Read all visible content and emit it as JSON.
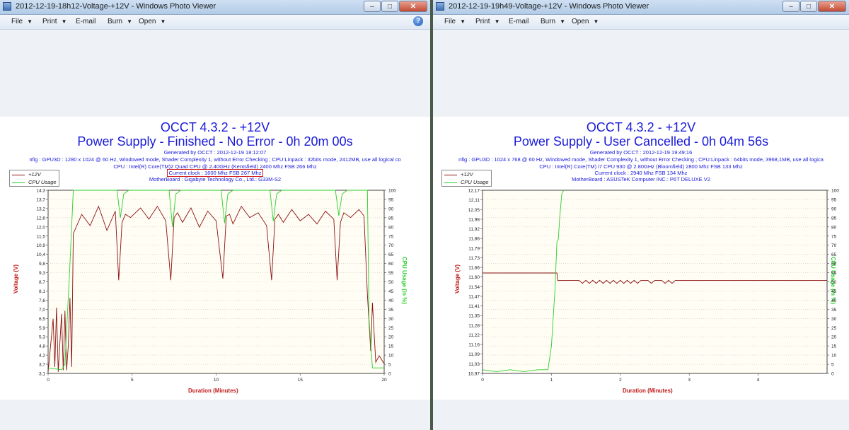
{
  "windows": [
    {
      "title": "2012-12-19-18h12-Voltage-+12V - Windows Photo Viewer",
      "menu": [
        "File",
        "Print",
        "E-mail",
        "Burn",
        "Open"
      ],
      "photo": {
        "title1": "OCCT 4.3.2 - +12V",
        "title2": "Power Supply - Finished - No Error - 0h 20m 00s",
        "generated": "Generated by OCCT : 2012-12-19 18:12:07",
        "config": "nfig : GPU3D : 1280 x 1024 @ 60 Hz, Windowed mode, Shader Complexity 1, without Error Checking ; CPU:Linpack : 32bits mode, 2412MB, use all logical co",
        "cpu": "CPU : Intel(R) Core(TM)2 Quad CPU @ 2.40GHz (Kentsfield) 2400 Mhz FSB 266 Mhz",
        "clock": "Current clock : 1600 Mhz FSB 267 Mhz",
        "mobo": "MotherBoard : Gigabyte Technology Co., Ltd.: G33M-S2",
        "legend_voltage": "+12V",
        "legend_cpu": "CPU Usage",
        "ylabel_left": "Voltage (V)",
        "ylabel_right": "CPU Usage (in %)",
        "xlabel": "Duration (Minutes)"
      },
      "chart_data": {
        "type": "line",
        "x_range": [
          0,
          20
        ],
        "x_ticks": [
          "0",
          "5",
          "10",
          "15",
          "20"
        ],
        "y_left_ticks": [
          "3,1",
          "3,7",
          "4,2",
          "4,8",
          "5,3",
          "5,9",
          "6,5",
          "7,0",
          "7,6",
          "8,1",
          "8,7",
          "9,3",
          "9,8",
          "10,4",
          "10,9",
          "11,5",
          "12,0",
          "12,6",
          "13,2",
          "13,7",
          "14,3"
        ],
        "y_left_range": [
          3.1,
          14.5
        ],
        "y_right_ticks": [
          "0",
          "5",
          "10",
          "15",
          "20",
          "25",
          "30",
          "35",
          "40",
          "45",
          "50",
          "55",
          "60",
          "65",
          "70",
          "75",
          "80",
          "85",
          "90",
          "95",
          "100"
        ],
        "y_right_range": [
          0,
          100
        ],
        "series": [
          {
            "name": "+12V",
            "axis": "left",
            "color": "#8b1010",
            "x": [
              0,
              0.3,
              0.4,
              0.5,
              0.6,
              0.8,
              0.9,
              1.0,
              1.1,
              1.2,
              1.3,
              1.4,
              1.5,
              2.0,
              2.5,
              3.0,
              3.5,
              4.0,
              4.2,
              4.4,
              4.6,
              4.9,
              5.5,
              6.0,
              6.5,
              7.0,
              7.3,
              7.5,
              7.7,
              8.0,
              8.5,
              9.0,
              9.5,
              10.0,
              10.4,
              10.6,
              10.8,
              11.0,
              11.5,
              12.0,
              12.5,
              13.0,
              13.3,
              13.5,
              13.7,
              14.0,
              14.5,
              15.0,
              15.5,
              16.0,
              16.5,
              17.0,
              17.2,
              17.4,
              17.6,
              18.0,
              18.5,
              18.8,
              19.0,
              19.2,
              19.3,
              19.5,
              19.7,
              20.0
            ],
            "y": [
              3.2,
              6.5,
              3.5,
              7.2,
              3.2,
              6.8,
              3.3,
              7.0,
              3.3,
              4.8,
              7.8,
              3.5,
              11.8,
              13.0,
              12.3,
              13.5,
              12.0,
              13.2,
              8.9,
              12.5,
              13.0,
              12.8,
              13.4,
              12.7,
              13.5,
              12.6,
              8.9,
              12.8,
              13.1,
              12.5,
              13.4,
              12.2,
              13.2,
              12.6,
              9.0,
              12.9,
              13.0,
              12.4,
              13.5,
              12.8,
              13.1,
              12.3,
              8.9,
              12.7,
              13.0,
              12.5,
              13.3,
              12.6,
              13.0,
              12.4,
              13.2,
              12.7,
              8.9,
              12.5,
              13.1,
              12.8,
              13.3,
              12.9,
              8.0,
              4.5,
              7.5,
              3.8,
              4.2,
              3.7
            ]
          },
          {
            "name": "CPU Usage",
            "axis": "right",
            "color": "#29d129",
            "x": [
              0,
              0.8,
              1.0,
              1.3,
              1.5,
              1.7,
              4.1,
              4.3,
              4.5,
              4.8,
              7.2,
              7.4,
              7.6,
              7.9,
              10.3,
              10.5,
              10.7,
              11.0,
              13.2,
              13.4,
              13.6,
              13.9,
              17.1,
              17.3,
              17.5,
              17.8,
              19.0,
              19.1,
              19.3,
              20.0
            ],
            "y": [
              3,
              2,
              5,
              60,
              100,
              100,
              100,
              85,
              98,
              100,
              100,
              80,
              98,
              100,
              100,
              82,
              98,
              100,
              100,
              83,
              98,
              100,
              100,
              86,
              98,
              100,
              100,
              30,
              3,
              3
            ]
          }
        ]
      }
    },
    {
      "title": "2012-12-19-19h49-Voltage-+12V - Windows Photo Viewer",
      "menu": [
        "File",
        "Print",
        "E-mail",
        "Burn",
        "Open"
      ],
      "photo": {
        "title1": "OCCT 4.3.2 - +12V",
        "title2": "Power Supply - User Cancelled - 0h 04m 56s",
        "generated": "Generated by OCCT : 2012-12-19 19:49:16",
        "config": "nfig : GPU3D : 1024 x 768 @ 60 Hz, Windowed mode, Shader Complexity 1, without Error Checking ; CPU:Linpack : 64bits mode, 3968,1MB, use all logica",
        "cpu": "CPU : Intel(R) Core(TM) i7 CPU 930 @ 2.80GHz (Bloomfield) 2800 Mhz FSB 133 Mhz",
        "clock": "Current clock : 2940 Mhz FSB 134 Mhz",
        "mobo": "MotherBoard : ASUSTeK Computer INC.: P6T DELUXE V2",
        "legend_voltage": "+12V",
        "legend_cpu": "CPU Usage",
        "ylabel_left": "Voltage (V)",
        "ylabel_right": "CPU Usage (in %)",
        "xlabel": "Duration (Minutes)"
      },
      "chart_data": {
        "type": "line",
        "x_range": [
          0,
          5
        ],
        "x_ticks": [
          "0",
          "1",
          "2",
          "3",
          "4"
        ],
        "y_left_ticks": [
          "10,97",
          "11,03",
          "11,09",
          "11,16",
          "11,22",
          "11,28",
          "11,35",
          "11,41",
          "11,47",
          "11,54",
          "11,60",
          "11,66",
          "11,73",
          "11,79",
          "11,86",
          "11,92",
          "11,98",
          "12,05",
          "12,11",
          "12,17"
        ],
        "y_left_range": [
          10.97,
          12.21
        ],
        "y_right_ticks": [
          "0",
          "5",
          "10",
          "15",
          "20",
          "25",
          "30",
          "35",
          "40",
          "45",
          "50",
          "55",
          "60",
          "65",
          "70",
          "75",
          "80",
          "85",
          "90",
          "95",
          "100"
        ],
        "y_right_range": [
          0,
          100
        ],
        "series": [
          {
            "name": "+12V",
            "axis": "left",
            "color": "#8b1010",
            "x": [
              0,
              1.08,
              1.09,
              1.4,
              1.45,
              1.5,
              1.55,
              1.6,
              1.65,
              1.7,
              1.75,
              1.8,
              1.85,
              1.9,
              1.95,
              2.0,
              2.05,
              2.1,
              2.15,
              2.2,
              2.25,
              2.3,
              2.4,
              2.45,
              2.5,
              2.6,
              2.65,
              2.7,
              2.75,
              2.8,
              5.0
            ],
            "y": [
              11.65,
              11.65,
              11.6,
              11.6,
              11.58,
              11.6,
              11.58,
              11.6,
              11.58,
              11.6,
              11.58,
              11.6,
              11.58,
              11.6,
              11.58,
              11.6,
              11.58,
              11.6,
              11.58,
              11.6,
              11.58,
              11.6,
              11.6,
              11.58,
              11.6,
              11.6,
              11.58,
              11.6,
              11.58,
              11.6,
              11.6
            ]
          },
          {
            "name": "CPU Usage",
            "axis": "right",
            "color": "#29d129",
            "x": [
              0,
              0.2,
              0.4,
              0.6,
              0.8,
              0.95,
              1.0,
              1.05,
              1.08,
              1.1,
              1.12,
              1.15,
              1.18
            ],
            "y": [
              2,
              1,
              2,
              1,
              2,
              2,
              15,
              45,
              72,
              73,
              85,
              98,
              100
            ]
          }
        ]
      }
    }
  ]
}
